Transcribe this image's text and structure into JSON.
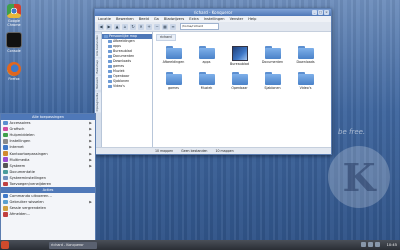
{
  "desktop": {
    "icons": [
      {
        "label": "Google Chrome",
        "color": "#e8b73a"
      },
      {
        "label": "Console",
        "color": "#111111"
      },
      {
        "label": "Firefox",
        "color": "#e0661f"
      }
    ],
    "wallpaper_text": "be free."
  },
  "filemanager": {
    "title": "richard - Konqueror",
    "menu": [
      "Locatie",
      "Bewerken",
      "Beeld",
      "Ga",
      "Bladwijzers",
      "Extra",
      "Instellingen",
      "Venster",
      "Help"
    ],
    "location": "/home/richard",
    "sidetabs": [
      "Alle bestanden",
      "Basismap",
      "Netwerk",
      "Opslagmedia"
    ],
    "tree_root": "Persoonlijke map",
    "tree": [
      "Afbeeldingen",
      "apps",
      "Bureaublad",
      "Documenten",
      "Downloads",
      "games",
      "Muziek",
      "Openbaar",
      "Sjablonen",
      "Video's"
    ],
    "breadcrumb": "richard",
    "items": [
      {
        "label": "Afbeeldingen",
        "kind": "folder"
      },
      {
        "label": "apps",
        "kind": "folder"
      },
      {
        "label": "Bureaublad",
        "kind": "thumb"
      },
      {
        "label": "Documenten",
        "kind": "folder"
      },
      {
        "label": "Downloads",
        "kind": "folder"
      },
      {
        "label": "games",
        "kind": "folder"
      },
      {
        "label": "Muziek",
        "kind": "folder"
      },
      {
        "label": "Openbaar",
        "kind": "folder"
      },
      {
        "label": "Sjablonen",
        "kind": "folder"
      },
      {
        "label": "Video's",
        "kind": "folder"
      }
    ],
    "status": [
      "10 mappen",
      "Geen bestanden",
      "10 mappen"
    ]
  },
  "startmenu": {
    "header": "Alle toepassingen",
    "items": [
      {
        "label": "Accessoires",
        "color": "#5a8fd0",
        "submenu": true
      },
      {
        "label": "Grafisch",
        "color": "#d04ba0",
        "submenu": true
      },
      {
        "label": "Hulpmiddelen",
        "color": "#3fa04b",
        "submenu": true
      },
      {
        "label": "Instellingen",
        "color": "#8a8a8a",
        "submenu": true
      },
      {
        "label": "Internet",
        "color": "#3f78c8",
        "submenu": true
      },
      {
        "label": "Kantoortoepassingen",
        "color": "#d08a2f",
        "submenu": true
      },
      {
        "label": "Multimedia",
        "color": "#9b4bd0",
        "submenu": true
      },
      {
        "label": "Systeem",
        "color": "#555555",
        "submenu": true
      },
      {
        "label": "Documentatie",
        "color": "#4a9c9c",
        "submenu": false
      },
      {
        "label": "Systeeminstellingen",
        "color": "#6f8fbd",
        "submenu": false
      },
      {
        "label": "Toevoegen/verwijderen",
        "color": "#c04040",
        "submenu": false
      }
    ],
    "actions_header": "Acties",
    "actions": [
      {
        "label": "Commando uitvoeren...",
        "color": "#3f78c8"
      },
      {
        "label": "Gebruiker wisselen",
        "color": "#5aa0d0",
        "submenu": true
      },
      {
        "label": "Sessie vergrendelen",
        "color": "#d0a03f"
      },
      {
        "label": "Afmelden...",
        "color": "#c03f3f"
      }
    ]
  },
  "taskbar": {
    "task": "richard - Konqueror",
    "clock": "10:45"
  }
}
